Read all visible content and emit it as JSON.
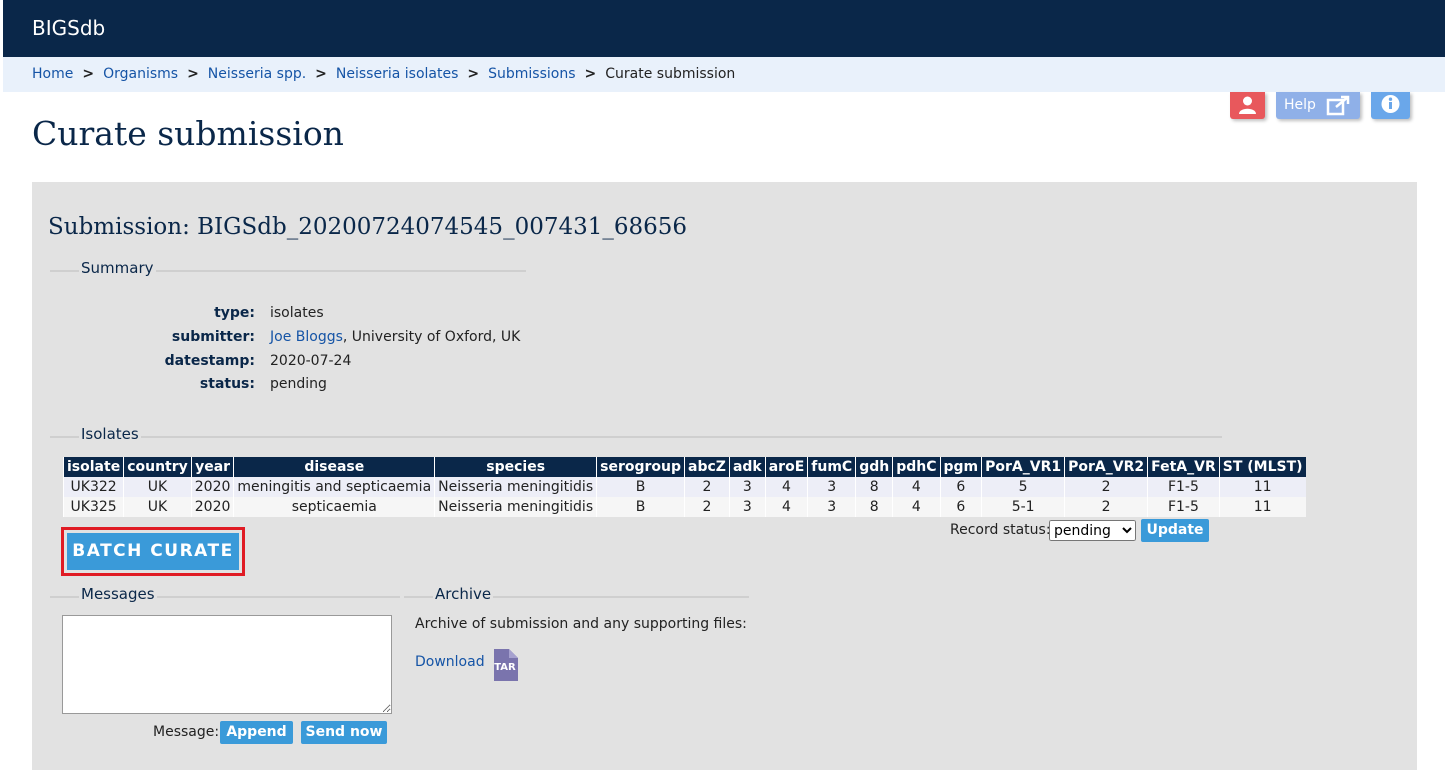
{
  "header": {
    "brand": "BIGSdb"
  },
  "breadcrumbs": [
    {
      "label": "Home"
    },
    {
      "label": "Organisms"
    },
    {
      "label": "Neisseria spp."
    },
    {
      "label": "Neisseria isolates"
    },
    {
      "label": "Submissions"
    },
    {
      "label": "Curate submission"
    }
  ],
  "toolbar": {
    "help_label": "Help",
    "user_icon": "user-icon",
    "external_icon": "external-link-icon",
    "info_icon": "info-icon"
  },
  "page": {
    "title": "Curate submission"
  },
  "submission": {
    "heading": "Submission: BIGSdb_20200724074545_007431_68656",
    "summary_legend": "Summary",
    "fields": {
      "type_label": "type:",
      "type_value": "isolates",
      "submitter_label": "submitter:",
      "submitter_name": "Joe Bloggs",
      "submitter_affiliation": ", University of Oxford, UK",
      "datestamp_label": "datestamp:",
      "datestamp_value": "2020-07-24",
      "status_label": "status:",
      "status_value": "pending"
    }
  },
  "isolates": {
    "legend": "Isolates",
    "columns": [
      "isolate",
      "country",
      "year",
      "disease",
      "species",
      "serogroup",
      "abcZ",
      "adk",
      "aroE",
      "fumC",
      "gdh",
      "pdhC",
      "pgm",
      "PorA_VR1",
      "PorA_VR2",
      "FetA_VR",
      "ST (MLST)"
    ],
    "rows": [
      [
        "UK322",
        "UK",
        "2020",
        "meningitis and septicaemia",
        "Neisseria meningitidis",
        "B",
        "2",
        "3",
        "4",
        "3",
        "8",
        "4",
        "6",
        "5",
        "2",
        "F1-5",
        "11"
      ],
      [
        "UK325",
        "UK",
        "2020",
        "septicaemia",
        "Neisseria meningitidis",
        "B",
        "2",
        "3",
        "4",
        "3",
        "8",
        "4",
        "6",
        "5-1",
        "2",
        "F1-5",
        "11"
      ]
    ],
    "record_status_label": "Record status:",
    "record_status_value": "pending",
    "update_label": "Update"
  },
  "batch_curate_label": "BATCH CURATE",
  "messages": {
    "legend": "Messages",
    "message_label": "Message:",
    "append_label": "Append",
    "send_label": "Send now"
  },
  "archive": {
    "legend": "Archive",
    "text": "Archive of submission and any supporting files:",
    "download_label": "Download",
    "file_icon_text": "TAR"
  }
}
